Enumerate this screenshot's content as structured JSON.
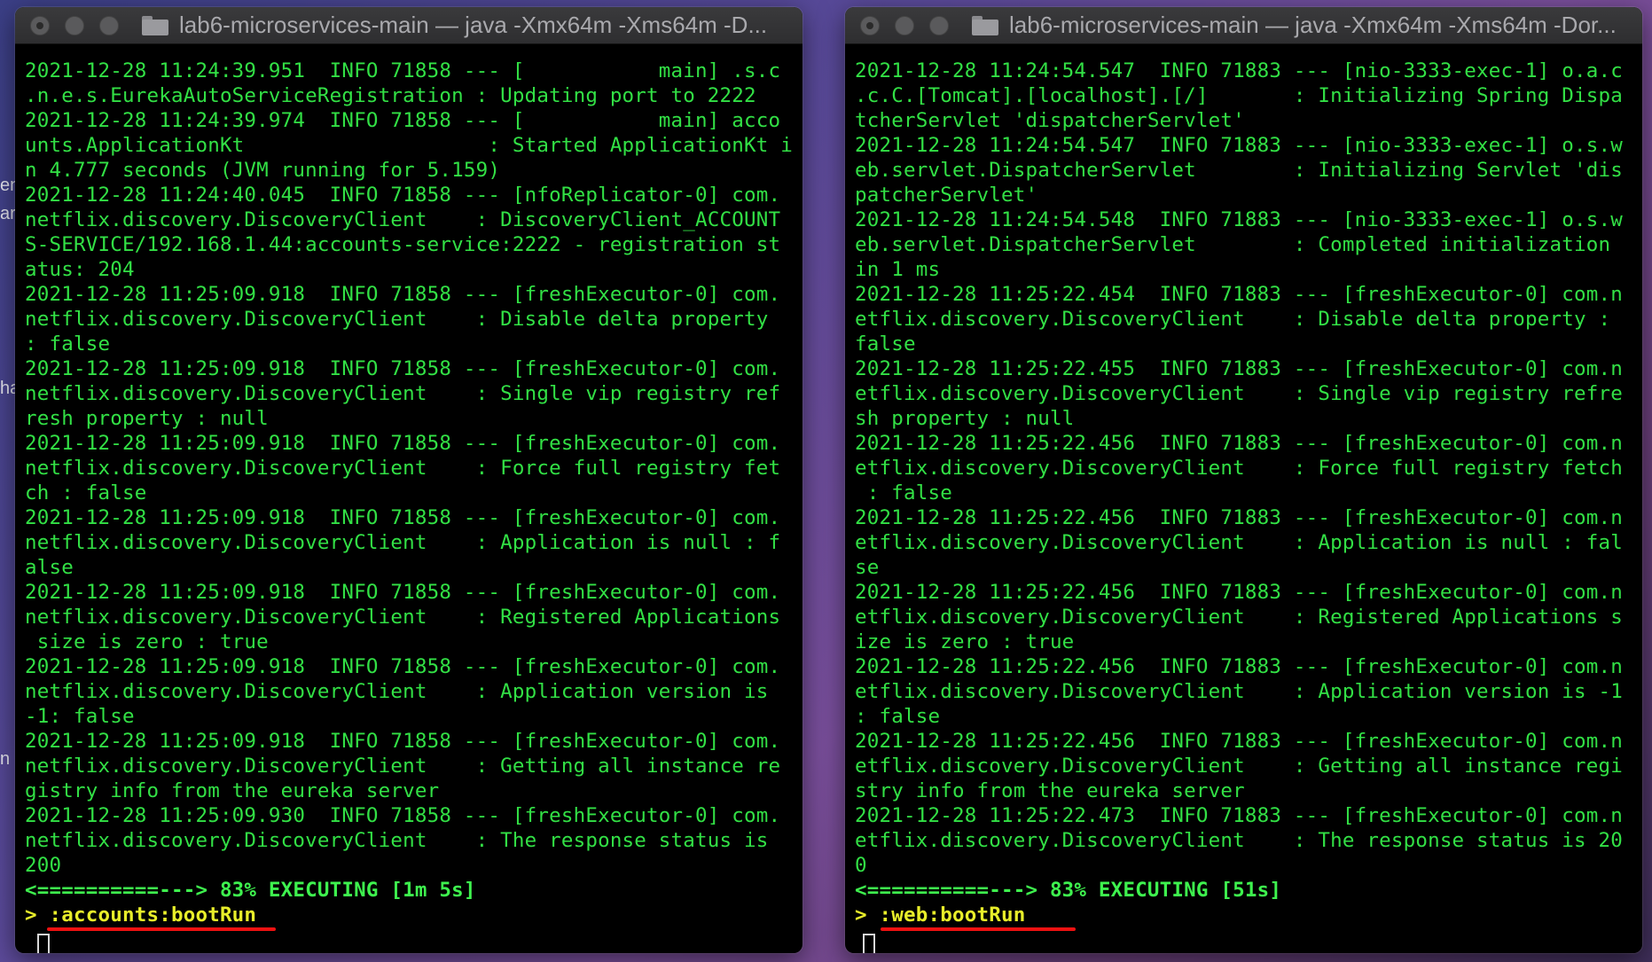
{
  "desktop": {
    "edge_text": [
      "en",
      "ar",
      "ha",
      "n"
    ]
  },
  "left_terminal": {
    "title": "lab6-microservices-main — java -Xmx64m -Xms64m -D...",
    "lines": [
      "2021-12-28 11:24:39.951  INFO 71858 --- [           main] .s.c",
      ".n.e.s.EurekaAutoServiceRegistration : Updating port to 2222",
      "2021-12-28 11:24:39.974  INFO 71858 --- [           main] acco",
      "unts.ApplicationKt                    : Started ApplicationKt i",
      "n 4.777 seconds (JVM running for 5.159)",
      "2021-12-28 11:24:40.045  INFO 71858 --- [nfoReplicator-0] com.",
      "netflix.discovery.DiscoveryClient    : DiscoveryClient_ACCOUNT",
      "S-SERVICE/192.168.1.44:accounts-service:2222 - registration st",
      "atus: 204",
      "2021-12-28 11:25:09.918  INFO 71858 --- [freshExecutor-0] com.",
      "netflix.discovery.DiscoveryClient    : Disable delta property",
      ": false",
      "2021-12-28 11:25:09.918  INFO 71858 --- [freshExecutor-0] com.",
      "netflix.discovery.DiscoveryClient    : Single vip registry ref",
      "resh property : null",
      "2021-12-28 11:25:09.918  INFO 71858 --- [freshExecutor-0] com.",
      "netflix.discovery.DiscoveryClient    : Force full registry fet",
      "ch : false",
      "2021-12-28 11:25:09.918  INFO 71858 --- [freshExecutor-0] com.",
      "netflix.discovery.DiscoveryClient    : Application is null : f",
      "alse",
      "2021-12-28 11:25:09.918  INFO 71858 --- [freshExecutor-0] com.",
      "netflix.discovery.DiscoveryClient    : Registered Applications",
      " size is zero : true",
      "2021-12-28 11:25:09.918  INFO 71858 --- [freshExecutor-0] com.",
      "netflix.discovery.DiscoveryClient    : Application version is",
      "-1: false",
      "2021-12-28 11:25:09.918  INFO 71858 --- [freshExecutor-0] com.",
      "netflix.discovery.DiscoveryClient    : Getting all instance re",
      "gistry info from the eureka server",
      "2021-12-28 11:25:09.930  INFO 71858 --- [freshExecutor-0] com.",
      "netflix.discovery.DiscoveryClient    : The response status is",
      "200"
    ],
    "status_line": "<==========---> 83% EXECUTING [1m 5s]",
    "task_line": "> :accounts:bootRun"
  },
  "right_terminal": {
    "title": "lab6-microservices-main — java -Xmx64m -Xms64m -Dor...",
    "lines": [
      "2021-12-28 11:24:54.547  INFO 71883 --- [nio-3333-exec-1] o.a.c",
      ".c.C.[Tomcat].[localhost].[/]       : Initializing Spring Dispa",
      "tcherServlet 'dispatcherServlet'",
      "2021-12-28 11:24:54.547  INFO 71883 --- [nio-3333-exec-1] o.s.w",
      "eb.servlet.DispatcherServlet        : Initializing Servlet 'dis",
      "patcherServlet'",
      "2021-12-28 11:24:54.548  INFO 71883 --- [nio-3333-exec-1] o.s.w",
      "eb.servlet.DispatcherServlet        : Completed initialization",
      "in 1 ms",
      "2021-12-28 11:25:22.454  INFO 71883 --- [freshExecutor-0] com.n",
      "etflix.discovery.DiscoveryClient    : Disable delta property :",
      "false",
      "2021-12-28 11:25:22.455  INFO 71883 --- [freshExecutor-0] com.n",
      "etflix.discovery.DiscoveryClient    : Single vip registry refre",
      "sh property : null",
      "2021-12-28 11:25:22.456  INFO 71883 --- [freshExecutor-0] com.n",
      "etflix.discovery.DiscoveryClient    : Force full registry fetch",
      " : false",
      "2021-12-28 11:25:22.456  INFO 71883 --- [freshExecutor-0] com.n",
      "etflix.discovery.DiscoveryClient    : Application is null : fal",
      "se",
      "2021-12-28 11:25:22.456  INFO 71883 --- [freshExecutor-0] com.n",
      "etflix.discovery.DiscoveryClient    : Registered Applications s",
      "ize is zero : true",
      "2021-12-28 11:25:22.456  INFO 71883 --- [freshExecutor-0] com.n",
      "etflix.discovery.DiscoveryClient    : Application version is -1",
      ": false",
      "2021-12-28 11:25:22.456  INFO 71883 --- [freshExecutor-0] com.n",
      "etflix.discovery.DiscoveryClient    : Getting all instance regi",
      "stry info from the eureka server",
      "2021-12-28 11:25:22.473  INFO 71883 --- [freshExecutor-0] com.n",
      "etflix.discovery.DiscoveryClient    : The response status is 20",
      "0"
    ],
    "status_line": "<==========---> 83% EXECUTING [51s]",
    "task_line": "> :web:bootRun"
  },
  "colors": {
    "terminal_text": "#32e045",
    "task_text": "#e8ee2a",
    "underline": "#e11111"
  }
}
